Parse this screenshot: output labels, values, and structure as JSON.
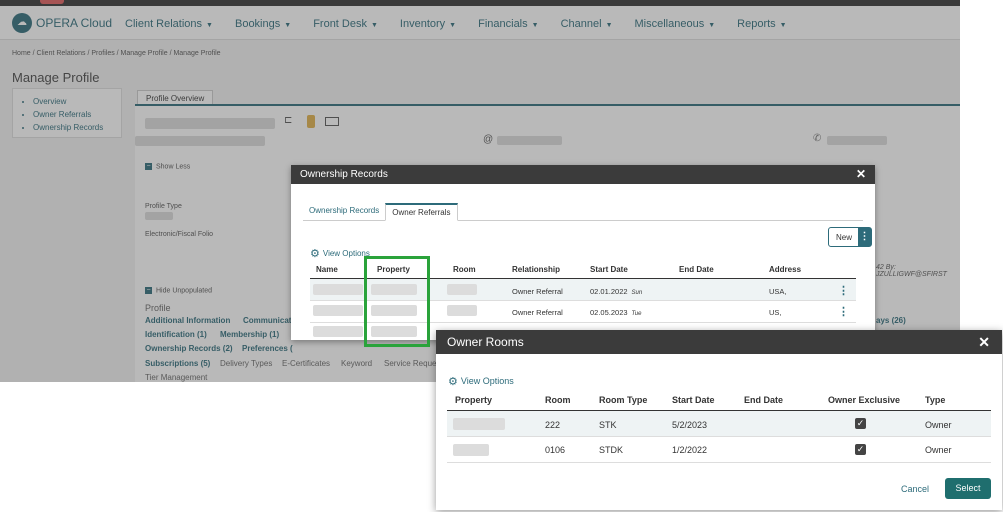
{
  "app": {
    "title": "OPERA Cloud",
    "nav": [
      "Client Relations",
      "Bookings",
      "Front Desk",
      "Inventory",
      "Financials",
      "Channel",
      "Miscellaneous",
      "Reports"
    ],
    "breadcrumb": "Home / Client Relations / Profiles / Manage Profile / Manage Profile",
    "page_title": "Manage Profile",
    "side_menu": [
      "Overview",
      "Owner Referrals",
      "Ownership Records"
    ],
    "profile_tab": "Profile Overview",
    "show_less": "Show Less",
    "profile_type_label": "Profile Type",
    "fiscal_label": "Electronic/Fiscal Folio",
    "hide_unpopulated": "Hide Unpopulated",
    "profile_heading": "Profile",
    "profile_links": {
      "additional": "Additional Information",
      "communications": "Communicat",
      "identification": "Identification (1)",
      "membership": "Membership (1)",
      "ownership": "Ownership Records (2)",
      "preferences": "Preferences (",
      "subscriptions": "Subscriptions (5)",
      "days": "ays (26)"
    },
    "sub_items": {
      "delivery": "Delivery Types",
      "ecert": "E-Certificates",
      "keyword": "Keyword",
      "servicereq": "Service Reques",
      "tier": "Tier Management"
    },
    "audit_text": "42  By: JZULLIGWF@SFIRST",
    "at_symbol": "@"
  },
  "ownership_dialog": {
    "title": "Ownership Records",
    "tabs": [
      "Ownership Records",
      "Owner Referrals"
    ],
    "active_tab": "Owner Referrals",
    "new_label": "New",
    "view_options": "View Options",
    "columns": [
      "Name",
      "Property",
      "Room",
      "Relationship",
      "Start Date",
      "End Date",
      "Address"
    ],
    "rows": [
      {
        "relationship": "Owner Referral",
        "start_date": "02.01.2022",
        "day": "Sun",
        "address": "USA,"
      },
      {
        "relationship": "Owner Referral",
        "start_date": "02.05.2023",
        "day": "Tue",
        "address": "US,"
      }
    ]
  },
  "rooms_dialog": {
    "title": "Owner Rooms",
    "view_options": "View Options",
    "columns": [
      "Property",
      "Room",
      "Room Type",
      "Start Date",
      "End Date",
      "Owner Exclusive",
      "Type"
    ],
    "rows": [
      {
        "room": "222",
        "room_type": "STK",
        "start_date": "5/2/2023",
        "end_date": "",
        "type": "Owner",
        "owner_exclusive": true
      },
      {
        "room": "0106",
        "room_type": "STDK",
        "start_date": "1/2/2022",
        "end_date": "",
        "type": "Owner",
        "owner_exclusive": true
      }
    ],
    "cancel_label": "Cancel",
    "select_label": "Select"
  },
  "colors": {
    "accent": "#2d6b7a",
    "header": "#3b3b3b",
    "highlight": "#2aa33b",
    "select_button": "#1f6e6e"
  }
}
